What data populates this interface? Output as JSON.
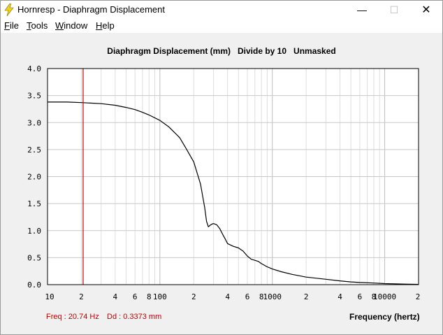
{
  "window": {
    "title": "Hornresp - Diaphragm Displacement",
    "minimize_glyph": "—",
    "maximize_glyph": "☐",
    "close_glyph": "✕"
  },
  "menu": [
    {
      "label": "File"
    },
    {
      "label": "Tools"
    },
    {
      "label": "Window"
    },
    {
      "label": "Help"
    }
  ],
  "plot": {
    "title": "Diaphragm Displacement (mm)   Divide by 10   Unmasked"
  },
  "readout": {
    "freq": "Freq : 20.74 Hz",
    "dd": "Dd : 0.3373 mm"
  },
  "colors": {
    "curve": "#000000",
    "cursor": "#cc0000",
    "grid": "#c8c8c8"
  },
  "chart_data": {
    "type": "line",
    "title": "Diaphragm Displacement (mm)   Divide by 10   Unmasked",
    "xlabel": "Frequency (hertz)",
    "ylabel": "",
    "x_scale": "log",
    "xlim": [
      10,
      20000
    ],
    "ylim": [
      0,
      4
    ],
    "grid": true,
    "yticks": [
      "4.0",
      "3.5",
      "3.0",
      "2.5",
      "2.0",
      "1.5",
      "1.0",
      "0.5",
      "0.0"
    ],
    "xticks": [
      "10",
      "2",
      "4",
      "6",
      "8",
      "100",
      "2",
      "4",
      "6",
      "8",
      "1000",
      "2",
      "4",
      "6",
      "8",
      "10000",
      "2"
    ],
    "cursor_x": 20.74,
    "series": [
      {
        "x": [
          10,
          15,
          20,
          30,
          40,
          50,
          60,
          70,
          80,
          100,
          120,
          150,
          170,
          200,
          230,
          250,
          260,
          270,
          280,
          290,
          300,
          320,
          340,
          360,
          380,
          400,
          450,
          500,
          550,
          600,
          650,
          700,
          750,
          800,
          900,
          1000,
          1200,
          1500,
          2000,
          3000,
          4000,
          5000,
          6000,
          8000,
          10000,
          15000,
          20000
        ],
        "y": [
          3.38,
          3.38,
          3.37,
          3.35,
          3.32,
          3.28,
          3.24,
          3.19,
          3.14,
          3.04,
          2.92,
          2.72,
          2.53,
          2.27,
          1.86,
          1.43,
          1.17,
          1.07,
          1.1,
          1.12,
          1.13,
          1.11,
          1.04,
          0.94,
          0.85,
          0.76,
          0.71,
          0.68,
          0.62,
          0.53,
          0.47,
          0.45,
          0.43,
          0.39,
          0.33,
          0.29,
          0.24,
          0.19,
          0.14,
          0.1,
          0.07,
          0.05,
          0.04,
          0.03,
          0.02,
          0.01,
          0.005
        ]
      }
    ]
  }
}
